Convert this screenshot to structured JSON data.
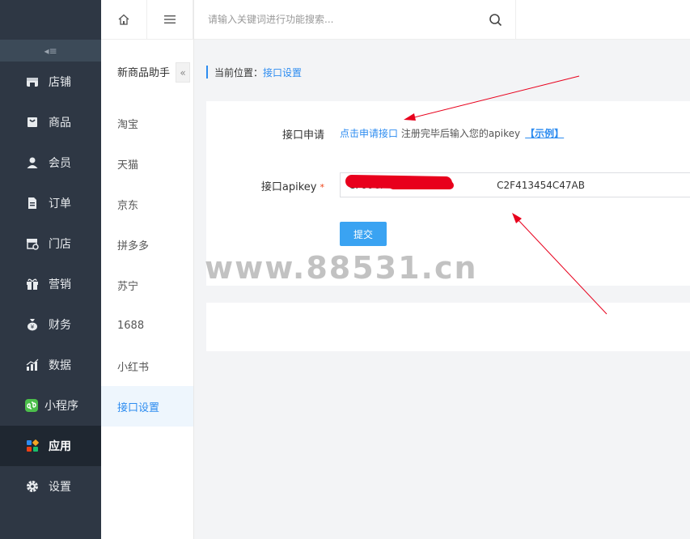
{
  "sidebar": {
    "collapse_glyph": "◂≡",
    "items": [
      {
        "label": "店铺",
        "icon": "store-icon"
      },
      {
        "label": "商品",
        "icon": "bag-icon"
      },
      {
        "label": "会员",
        "icon": "user-icon"
      },
      {
        "label": "订单",
        "icon": "document-icon"
      },
      {
        "label": "门店",
        "icon": "shop-settings-icon"
      },
      {
        "label": "营销",
        "icon": "gift-icon"
      },
      {
        "label": "财务",
        "icon": "money-bag-icon"
      },
      {
        "label": "数据",
        "icon": "chart-icon"
      },
      {
        "label": "小程序",
        "icon": "miniprogram-icon"
      },
      {
        "label": "应用",
        "icon": "apps-icon",
        "active": true
      },
      {
        "label": "设置",
        "icon": "gear-icon"
      }
    ]
  },
  "subnav": {
    "title": "新商品助手",
    "collapse_glyph": "«",
    "items": [
      {
        "label": "淘宝"
      },
      {
        "label": "天猫"
      },
      {
        "label": "京东"
      },
      {
        "label": "拼多多"
      },
      {
        "label": "苏宁"
      },
      {
        "label": "1688"
      },
      {
        "label": "小红书"
      },
      {
        "label": "接口设置",
        "active": true
      }
    ]
  },
  "search": {
    "placeholder": "请输入关键词进行功能搜索..."
  },
  "breadcrumb": {
    "prefix": "当前位置：",
    "current": "接口设置"
  },
  "form": {
    "apply_label": "接口申请",
    "apply_link": "点击申请接口",
    "apply_text": " 注册完毕后输入您的apikey",
    "example_link": "【示例】",
    "apikey_label": "接口apikey",
    "required_mark": "*",
    "apikey_value": "CF00CF                                    C2F413454C47AB",
    "submit_label": "提交"
  },
  "watermark": "www.88531.cn",
  "colors": {
    "sidebar_bg": "#2e3744",
    "accent": "#2d8cf0",
    "button": "#3aa3f2",
    "annotation_red": "#e8001c"
  }
}
